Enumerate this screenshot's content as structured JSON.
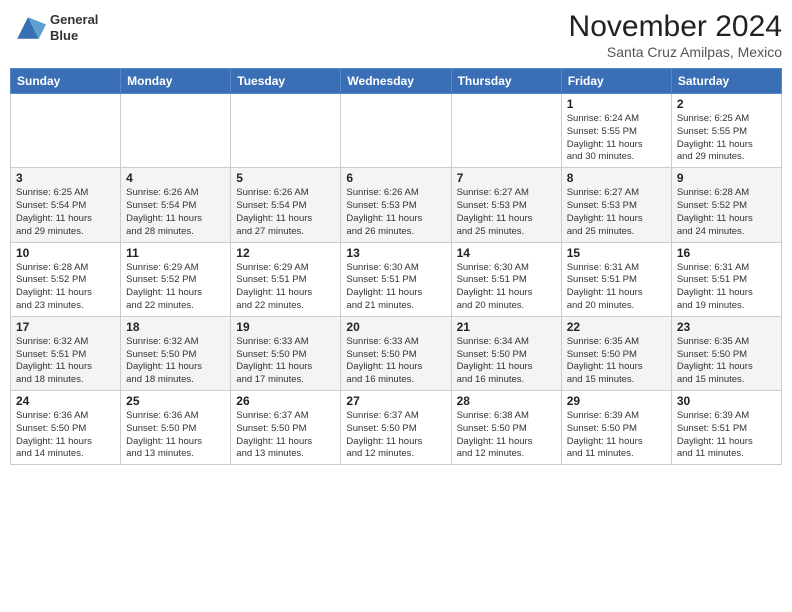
{
  "logo": {
    "line1": "General",
    "line2": "Blue"
  },
  "title": "November 2024",
  "subtitle": "Santa Cruz Amilpas, Mexico",
  "weekdays": [
    "Sunday",
    "Monday",
    "Tuesday",
    "Wednesday",
    "Thursday",
    "Friday",
    "Saturday"
  ],
  "weeks": [
    [
      {
        "day": "",
        "info": ""
      },
      {
        "day": "",
        "info": ""
      },
      {
        "day": "",
        "info": ""
      },
      {
        "day": "",
        "info": ""
      },
      {
        "day": "",
        "info": ""
      },
      {
        "day": "1",
        "info": "Sunrise: 6:24 AM\nSunset: 5:55 PM\nDaylight: 11 hours\nand 30 minutes."
      },
      {
        "day": "2",
        "info": "Sunrise: 6:25 AM\nSunset: 5:55 PM\nDaylight: 11 hours\nand 29 minutes."
      }
    ],
    [
      {
        "day": "3",
        "info": "Sunrise: 6:25 AM\nSunset: 5:54 PM\nDaylight: 11 hours\nand 29 minutes."
      },
      {
        "day": "4",
        "info": "Sunrise: 6:26 AM\nSunset: 5:54 PM\nDaylight: 11 hours\nand 28 minutes."
      },
      {
        "day": "5",
        "info": "Sunrise: 6:26 AM\nSunset: 5:54 PM\nDaylight: 11 hours\nand 27 minutes."
      },
      {
        "day": "6",
        "info": "Sunrise: 6:26 AM\nSunset: 5:53 PM\nDaylight: 11 hours\nand 26 minutes."
      },
      {
        "day": "7",
        "info": "Sunrise: 6:27 AM\nSunset: 5:53 PM\nDaylight: 11 hours\nand 25 minutes."
      },
      {
        "day": "8",
        "info": "Sunrise: 6:27 AM\nSunset: 5:53 PM\nDaylight: 11 hours\nand 25 minutes."
      },
      {
        "day": "9",
        "info": "Sunrise: 6:28 AM\nSunset: 5:52 PM\nDaylight: 11 hours\nand 24 minutes."
      }
    ],
    [
      {
        "day": "10",
        "info": "Sunrise: 6:28 AM\nSunset: 5:52 PM\nDaylight: 11 hours\nand 23 minutes."
      },
      {
        "day": "11",
        "info": "Sunrise: 6:29 AM\nSunset: 5:52 PM\nDaylight: 11 hours\nand 22 minutes."
      },
      {
        "day": "12",
        "info": "Sunrise: 6:29 AM\nSunset: 5:51 PM\nDaylight: 11 hours\nand 22 minutes."
      },
      {
        "day": "13",
        "info": "Sunrise: 6:30 AM\nSunset: 5:51 PM\nDaylight: 11 hours\nand 21 minutes."
      },
      {
        "day": "14",
        "info": "Sunrise: 6:30 AM\nSunset: 5:51 PM\nDaylight: 11 hours\nand 20 minutes."
      },
      {
        "day": "15",
        "info": "Sunrise: 6:31 AM\nSunset: 5:51 PM\nDaylight: 11 hours\nand 20 minutes."
      },
      {
        "day": "16",
        "info": "Sunrise: 6:31 AM\nSunset: 5:51 PM\nDaylight: 11 hours\nand 19 minutes."
      }
    ],
    [
      {
        "day": "17",
        "info": "Sunrise: 6:32 AM\nSunset: 5:51 PM\nDaylight: 11 hours\nand 18 minutes."
      },
      {
        "day": "18",
        "info": "Sunrise: 6:32 AM\nSunset: 5:50 PM\nDaylight: 11 hours\nand 18 minutes."
      },
      {
        "day": "19",
        "info": "Sunrise: 6:33 AM\nSunset: 5:50 PM\nDaylight: 11 hours\nand 17 minutes."
      },
      {
        "day": "20",
        "info": "Sunrise: 6:33 AM\nSunset: 5:50 PM\nDaylight: 11 hours\nand 16 minutes."
      },
      {
        "day": "21",
        "info": "Sunrise: 6:34 AM\nSunset: 5:50 PM\nDaylight: 11 hours\nand 16 minutes."
      },
      {
        "day": "22",
        "info": "Sunrise: 6:35 AM\nSunset: 5:50 PM\nDaylight: 11 hours\nand 15 minutes."
      },
      {
        "day": "23",
        "info": "Sunrise: 6:35 AM\nSunset: 5:50 PM\nDaylight: 11 hours\nand 15 minutes."
      }
    ],
    [
      {
        "day": "24",
        "info": "Sunrise: 6:36 AM\nSunset: 5:50 PM\nDaylight: 11 hours\nand 14 minutes."
      },
      {
        "day": "25",
        "info": "Sunrise: 6:36 AM\nSunset: 5:50 PM\nDaylight: 11 hours\nand 13 minutes."
      },
      {
        "day": "26",
        "info": "Sunrise: 6:37 AM\nSunset: 5:50 PM\nDaylight: 11 hours\nand 13 minutes."
      },
      {
        "day": "27",
        "info": "Sunrise: 6:37 AM\nSunset: 5:50 PM\nDaylight: 11 hours\nand 12 minutes."
      },
      {
        "day": "28",
        "info": "Sunrise: 6:38 AM\nSunset: 5:50 PM\nDaylight: 11 hours\nand 12 minutes."
      },
      {
        "day": "29",
        "info": "Sunrise: 6:39 AM\nSunset: 5:50 PM\nDaylight: 11 hours\nand 11 minutes."
      },
      {
        "day": "30",
        "info": "Sunrise: 6:39 AM\nSunset: 5:51 PM\nDaylight: 11 hours\nand 11 minutes."
      }
    ]
  ]
}
